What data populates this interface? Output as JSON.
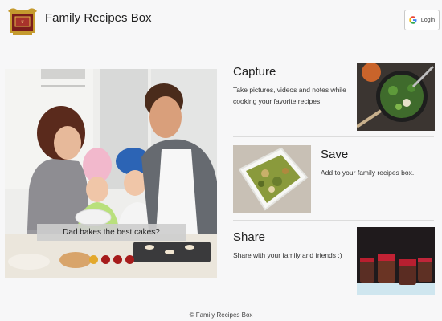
{
  "header": {
    "app_title": "Family Recipes Box",
    "login_label": "Login",
    "logo_icon": "recipe-box-logo-icon",
    "login_icon": "google-icon"
  },
  "hero": {
    "caption": "Dad bakes the best cakes?",
    "carousel": {
      "slide_count": 4,
      "active_index": 0,
      "active_color": "#e3a82b",
      "inactive_color": "#a61b1b"
    }
  },
  "features": [
    {
      "title": "Capture",
      "text": "Take pictures, videos and notes while cooking your favorite recipes."
    },
    {
      "title": "Save",
      "text": "Add to your family recipes box."
    },
    {
      "title": "Share",
      "text": "Share with your family and friends :)"
    }
  ],
  "footer": {
    "copyright": "© Family Recipes Box"
  }
}
